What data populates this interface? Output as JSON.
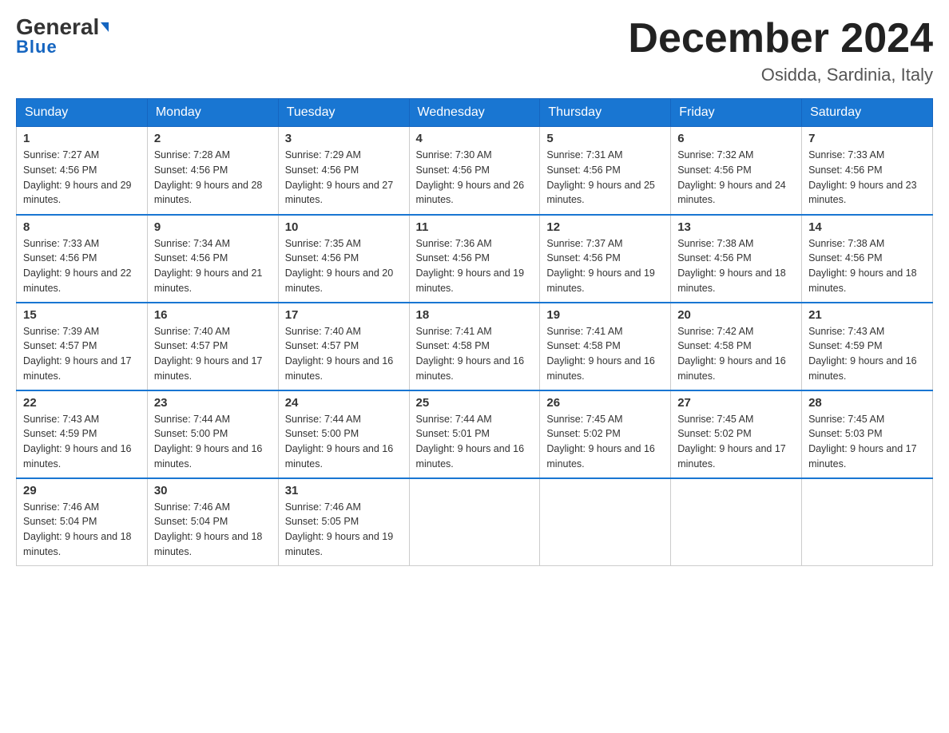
{
  "header": {
    "logo_general": "General",
    "logo_blue": "Blue",
    "month_title": "December 2024",
    "location": "Osidda, Sardinia, Italy"
  },
  "days_of_week": [
    "Sunday",
    "Monday",
    "Tuesday",
    "Wednesday",
    "Thursday",
    "Friday",
    "Saturday"
  ],
  "weeks": [
    [
      {
        "num": "1",
        "sunrise": "7:27 AM",
        "sunset": "4:56 PM",
        "daylight": "9 hours and 29 minutes."
      },
      {
        "num": "2",
        "sunrise": "7:28 AM",
        "sunset": "4:56 PM",
        "daylight": "9 hours and 28 minutes."
      },
      {
        "num": "3",
        "sunrise": "7:29 AM",
        "sunset": "4:56 PM",
        "daylight": "9 hours and 27 minutes."
      },
      {
        "num": "4",
        "sunrise": "7:30 AM",
        "sunset": "4:56 PM",
        "daylight": "9 hours and 26 minutes."
      },
      {
        "num": "5",
        "sunrise": "7:31 AM",
        "sunset": "4:56 PM",
        "daylight": "9 hours and 25 minutes."
      },
      {
        "num": "6",
        "sunrise": "7:32 AM",
        "sunset": "4:56 PM",
        "daylight": "9 hours and 24 minutes."
      },
      {
        "num": "7",
        "sunrise": "7:33 AM",
        "sunset": "4:56 PM",
        "daylight": "9 hours and 23 minutes."
      }
    ],
    [
      {
        "num": "8",
        "sunrise": "7:33 AM",
        "sunset": "4:56 PM",
        "daylight": "9 hours and 22 minutes."
      },
      {
        "num": "9",
        "sunrise": "7:34 AM",
        "sunset": "4:56 PM",
        "daylight": "9 hours and 21 minutes."
      },
      {
        "num": "10",
        "sunrise": "7:35 AM",
        "sunset": "4:56 PM",
        "daylight": "9 hours and 20 minutes."
      },
      {
        "num": "11",
        "sunrise": "7:36 AM",
        "sunset": "4:56 PM",
        "daylight": "9 hours and 19 minutes."
      },
      {
        "num": "12",
        "sunrise": "7:37 AM",
        "sunset": "4:56 PM",
        "daylight": "9 hours and 19 minutes."
      },
      {
        "num": "13",
        "sunrise": "7:38 AM",
        "sunset": "4:56 PM",
        "daylight": "9 hours and 18 minutes."
      },
      {
        "num": "14",
        "sunrise": "7:38 AM",
        "sunset": "4:56 PM",
        "daylight": "9 hours and 18 minutes."
      }
    ],
    [
      {
        "num": "15",
        "sunrise": "7:39 AM",
        "sunset": "4:57 PM",
        "daylight": "9 hours and 17 minutes."
      },
      {
        "num": "16",
        "sunrise": "7:40 AM",
        "sunset": "4:57 PM",
        "daylight": "9 hours and 17 minutes."
      },
      {
        "num": "17",
        "sunrise": "7:40 AM",
        "sunset": "4:57 PM",
        "daylight": "9 hours and 16 minutes."
      },
      {
        "num": "18",
        "sunrise": "7:41 AM",
        "sunset": "4:58 PM",
        "daylight": "9 hours and 16 minutes."
      },
      {
        "num": "19",
        "sunrise": "7:41 AM",
        "sunset": "4:58 PM",
        "daylight": "9 hours and 16 minutes."
      },
      {
        "num": "20",
        "sunrise": "7:42 AM",
        "sunset": "4:58 PM",
        "daylight": "9 hours and 16 minutes."
      },
      {
        "num": "21",
        "sunrise": "7:43 AM",
        "sunset": "4:59 PM",
        "daylight": "9 hours and 16 minutes."
      }
    ],
    [
      {
        "num": "22",
        "sunrise": "7:43 AM",
        "sunset": "4:59 PM",
        "daylight": "9 hours and 16 minutes."
      },
      {
        "num": "23",
        "sunrise": "7:44 AM",
        "sunset": "5:00 PM",
        "daylight": "9 hours and 16 minutes."
      },
      {
        "num": "24",
        "sunrise": "7:44 AM",
        "sunset": "5:00 PM",
        "daylight": "9 hours and 16 minutes."
      },
      {
        "num": "25",
        "sunrise": "7:44 AM",
        "sunset": "5:01 PM",
        "daylight": "9 hours and 16 minutes."
      },
      {
        "num": "26",
        "sunrise": "7:45 AM",
        "sunset": "5:02 PM",
        "daylight": "9 hours and 16 minutes."
      },
      {
        "num": "27",
        "sunrise": "7:45 AM",
        "sunset": "5:02 PM",
        "daylight": "9 hours and 17 minutes."
      },
      {
        "num": "28",
        "sunrise": "7:45 AM",
        "sunset": "5:03 PM",
        "daylight": "9 hours and 17 minutes."
      }
    ],
    [
      {
        "num": "29",
        "sunrise": "7:46 AM",
        "sunset": "5:04 PM",
        "daylight": "9 hours and 18 minutes."
      },
      {
        "num": "30",
        "sunrise": "7:46 AM",
        "sunset": "5:04 PM",
        "daylight": "9 hours and 18 minutes."
      },
      {
        "num": "31",
        "sunrise": "7:46 AM",
        "sunset": "5:05 PM",
        "daylight": "9 hours and 19 minutes."
      },
      null,
      null,
      null,
      null
    ]
  ]
}
